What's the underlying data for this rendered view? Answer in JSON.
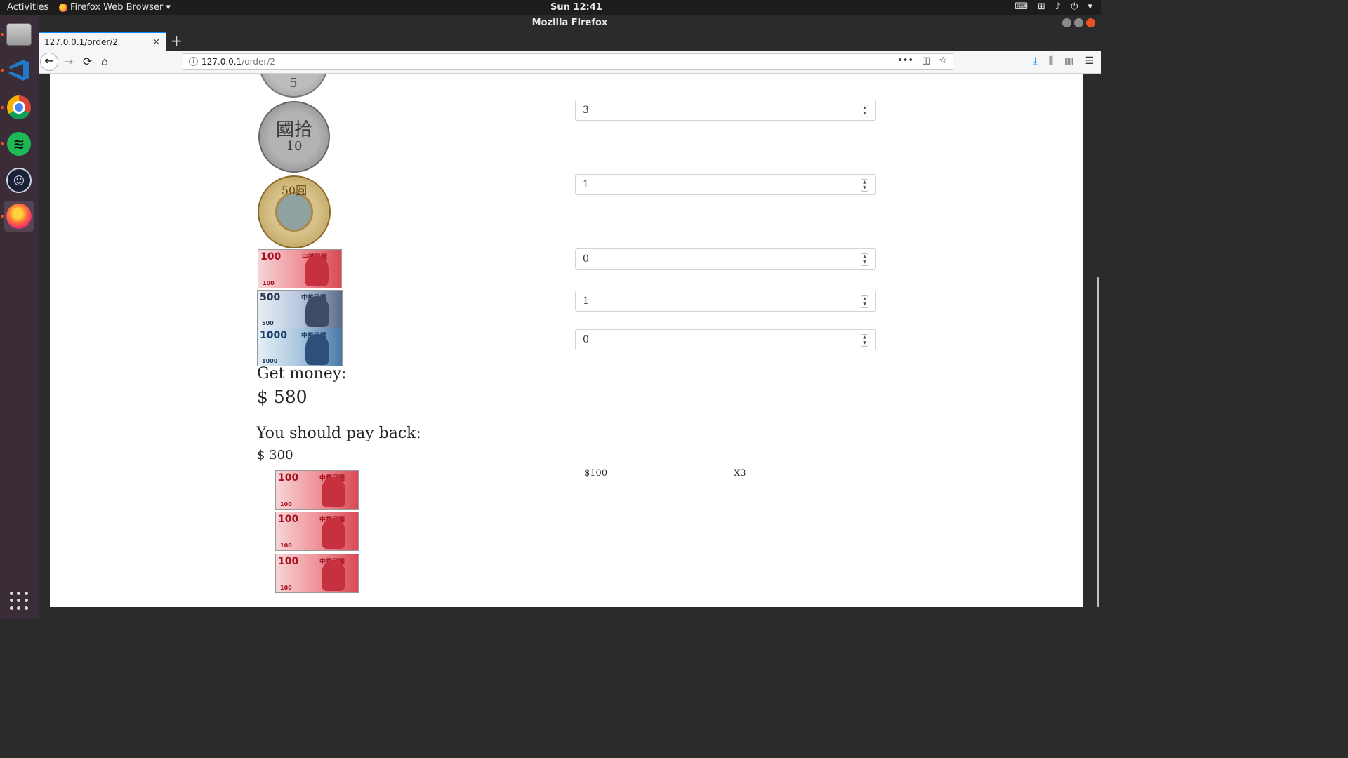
{
  "system": {
    "activities": "Activities",
    "app_menu": "Firefox Web Browser",
    "clock": "Sun 12:41"
  },
  "window": {
    "title": "Mozilla Firefox"
  },
  "tabs": [
    {
      "title": "127.0.0.1/order/2",
      "close": "×"
    }
  ],
  "new_tab": "+",
  "address_bar": {
    "host": "127.0.0.1",
    "path": "/order/2"
  },
  "nav": {
    "back": "←",
    "forward": "→",
    "reload": "⟳",
    "home": "⌂"
  },
  "page": {
    "coin_labels": {
      "five": "5",
      "ten_top": "國拾",
      "ten_bottom": "10",
      "fifty": "50圓"
    },
    "note_labels": {
      "n100": "100",
      "n100_small": "100",
      "n500": "500",
      "n500_small": "500",
      "n1000": "1000",
      "n1000_small": "1000",
      "script": "中華民國"
    },
    "quantities": [
      {
        "denomination": "10",
        "value": "3"
      },
      {
        "denomination": "50",
        "value": "1"
      },
      {
        "denomination": "100",
        "value": "0"
      },
      {
        "denomination": "500",
        "value": "1"
      },
      {
        "denomination": "1000",
        "value": "0"
      }
    ],
    "get_money_label": "Get money:",
    "get_money_value": "$ 580",
    "pay_back_label": "You should pay back:",
    "pay_back_value": "$ 300",
    "pay_back_rows": [
      {
        "denomination": "$100",
        "count": "X3"
      }
    ]
  }
}
